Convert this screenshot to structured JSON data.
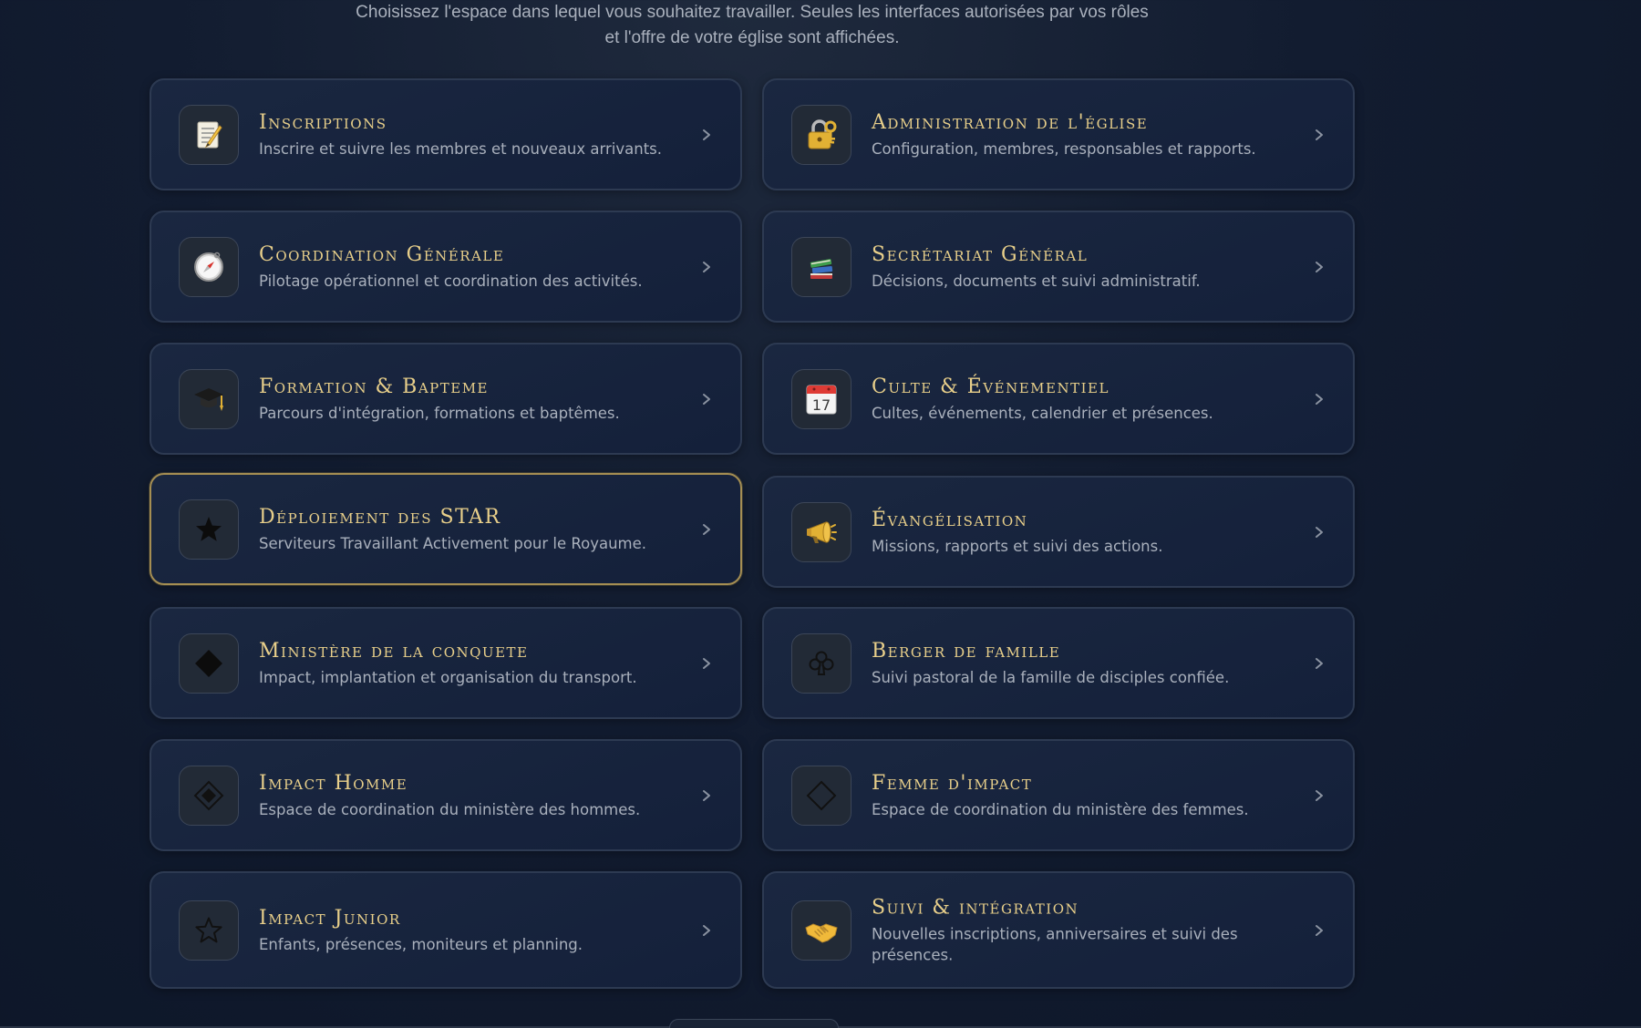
{
  "intro_text": "Choisissez l'espace dans lequel vous souhaitez travailler. Seules les interfaces autorisées par vos rôles et l'offre de votre église sont affichées.",
  "spaces": [
    {
      "title": "Inscriptions",
      "description": "Inscrire et suivre les membres et nouveaux arrivants.",
      "icon": "memo-icon"
    },
    {
      "title": "Administration de l'église",
      "description": "Configuration, membres, responsables et rapports.",
      "icon": "lock-key-icon"
    },
    {
      "title": "Coordination Générale",
      "description": "Pilotage opérationnel et coordination des activités.",
      "icon": "compass-icon"
    },
    {
      "title": "Secrétariat Général",
      "description": "Décisions, documents et suivi administratif.",
      "icon": "books-icon"
    },
    {
      "title": "Formation & Bapteme",
      "description": "Parcours d'intégration, formations et baptêmes.",
      "icon": "graduation-cap-icon"
    },
    {
      "title": "Culte & Événementiel",
      "description": "Cultes, événements, calendrier et présences.",
      "icon": "calendar-icon",
      "calendar_day": "17"
    },
    {
      "title": "Déploiement des STAR",
      "description": "Serviteurs Travaillant Activement pour le Royaume.",
      "icon": "star-filled-icon",
      "active": true
    },
    {
      "title": "Évangélisation",
      "description": "Missions, rapports et suivi des actions.",
      "icon": "megaphone-icon"
    },
    {
      "title": "Ministère de la conquete",
      "description": "Impact, implantation et organisation du transport.",
      "icon": "diamond-filled-icon"
    },
    {
      "title": "Berger de famille",
      "description": "Suivi pastoral de la famille de disciples confiée.",
      "icon": "club-icon"
    },
    {
      "title": "Impact Homme",
      "description": "Espace de coordination du ministère des hommes.",
      "icon": "diamond-dot-icon"
    },
    {
      "title": "Femme d'impact",
      "description": "Espace de coordination du ministère des femmes.",
      "icon": "diamond-outline-icon"
    },
    {
      "title": "Impact Junior",
      "description": "Enfants, présences, moniteurs et planning.",
      "icon": "star-outline-icon"
    },
    {
      "title": "Suivi & intégration",
      "description": "Nouvelles inscriptions, anniversaires et suivi des présences.",
      "icon": "handshake-icon"
    }
  ],
  "colors": {
    "title_gold": "#e8cf8a",
    "active_border": "#a58e52",
    "card_border": "#2d3a52",
    "background": "#121c30"
  }
}
